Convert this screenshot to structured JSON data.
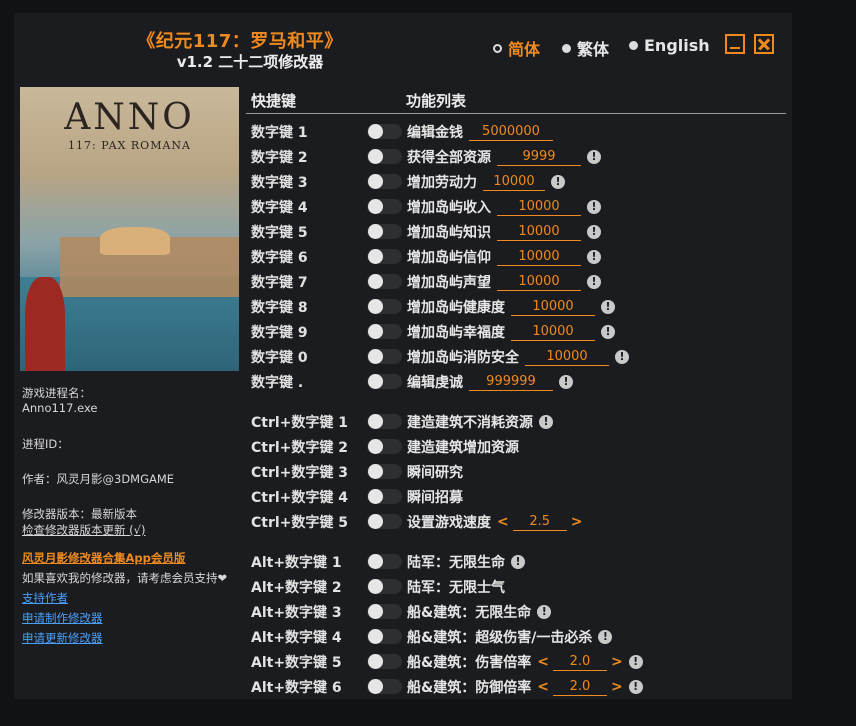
{
  "app": {
    "title": "《纪元117：罗马和平》",
    "subtitle": "v1.2 二十二项修改器"
  },
  "languages": [
    {
      "label": "简体",
      "selected": true
    },
    {
      "label": "繁体",
      "selected": false
    },
    {
      "label": "English",
      "selected": false
    }
  ],
  "window_buttons": {
    "minimize": "minimize-icon",
    "close": "close-icon"
  },
  "cover": {
    "logo": "ANNO",
    "subtitle": "117: PAX ROMANA"
  },
  "info": {
    "process_label": "游戏进程名：",
    "process_value": "Anno117.exe",
    "pid_label": "进程ID：",
    "author": "作者：风灵月影@3DMGAME",
    "version": "修改器版本：最新版本",
    "check_update": "检查修改器版本更新 (√)",
    "app_link": "风灵月影修改器合集App会员版",
    "support_text": "如果喜欢我的修改器，请考虑会员支持",
    "heart": "❤",
    "link_support": "支持作者",
    "link_request": "申请制作修改器",
    "link_update": "申请更新修改器"
  },
  "headers": {
    "hotkey": "快捷键",
    "features": "功能列表"
  },
  "colors": {
    "accent": "#f08a1e",
    "link": "#4aa0ff",
    "background": "#1b1c1f"
  },
  "rows": [
    {
      "key": "数字键 1",
      "fn": "编辑金钱",
      "value": "5000000",
      "info": false
    },
    {
      "key": "数字键 2",
      "fn": "获得全部资源",
      "value": "9999",
      "info": true
    },
    {
      "key": "数字键 3",
      "fn": "增加劳动力",
      "value": "10000",
      "info": true
    },
    {
      "key": "数字键 4",
      "fn": "增加岛屿收入",
      "value": "10000",
      "info": true
    },
    {
      "key": "数字键 5",
      "fn": "增加岛屿知识",
      "value": "10000",
      "info": true
    },
    {
      "key": "数字键 6",
      "fn": "增加岛屿信仰",
      "value": "10000",
      "info": true
    },
    {
      "key": "数字键 7",
      "fn": "增加岛屿声望",
      "value": "10000",
      "info": true
    },
    {
      "key": "数字键 8",
      "fn": "增加岛屿健康度",
      "value": "10000",
      "info": true
    },
    {
      "key": "数字键 9",
      "fn": "增加岛屿幸福度",
      "value": "10000",
      "info": true
    },
    {
      "key": "数字键 0",
      "fn": "增加岛屿消防安全",
      "value": "10000",
      "info": true
    },
    {
      "key": "数字键 .",
      "fn": "编辑虔诚",
      "value": "999999",
      "info": true
    },
    {
      "key": "Ctrl+数字键 1",
      "fn": "建造建筑不消耗资源",
      "info": true
    },
    {
      "key": "Ctrl+数字键 2",
      "fn": "建造建筑增加资源",
      "info": false
    },
    {
      "key": "Ctrl+数字键 3",
      "fn": "瞬间研究",
      "info": false
    },
    {
      "key": "Ctrl+数字键 4",
      "fn": "瞬间招募",
      "info": false
    },
    {
      "key": "Ctrl+数字键 5",
      "fn": "设置游戏速度",
      "stepper": "2.5",
      "info": false
    },
    {
      "key": "Alt+数字键 1",
      "fn": "陆军：无限生命",
      "info": true
    },
    {
      "key": "Alt+数字键 2",
      "fn": "陆军：无限士气",
      "info": false
    },
    {
      "key": "Alt+数字键 3",
      "fn": "船&建筑：无限生命",
      "info": true
    },
    {
      "key": "Alt+数字键 4",
      "fn": "船&建筑：超级伤害/一击必杀",
      "info": true
    },
    {
      "key": "Alt+数字键 5",
      "fn": "船&建筑：伤害倍率",
      "stepper": "2.0",
      "info": true
    },
    {
      "key": "Alt+数字键 6",
      "fn": "船&建筑：防御倍率",
      "stepper": "2.0",
      "info": true
    }
  ]
}
